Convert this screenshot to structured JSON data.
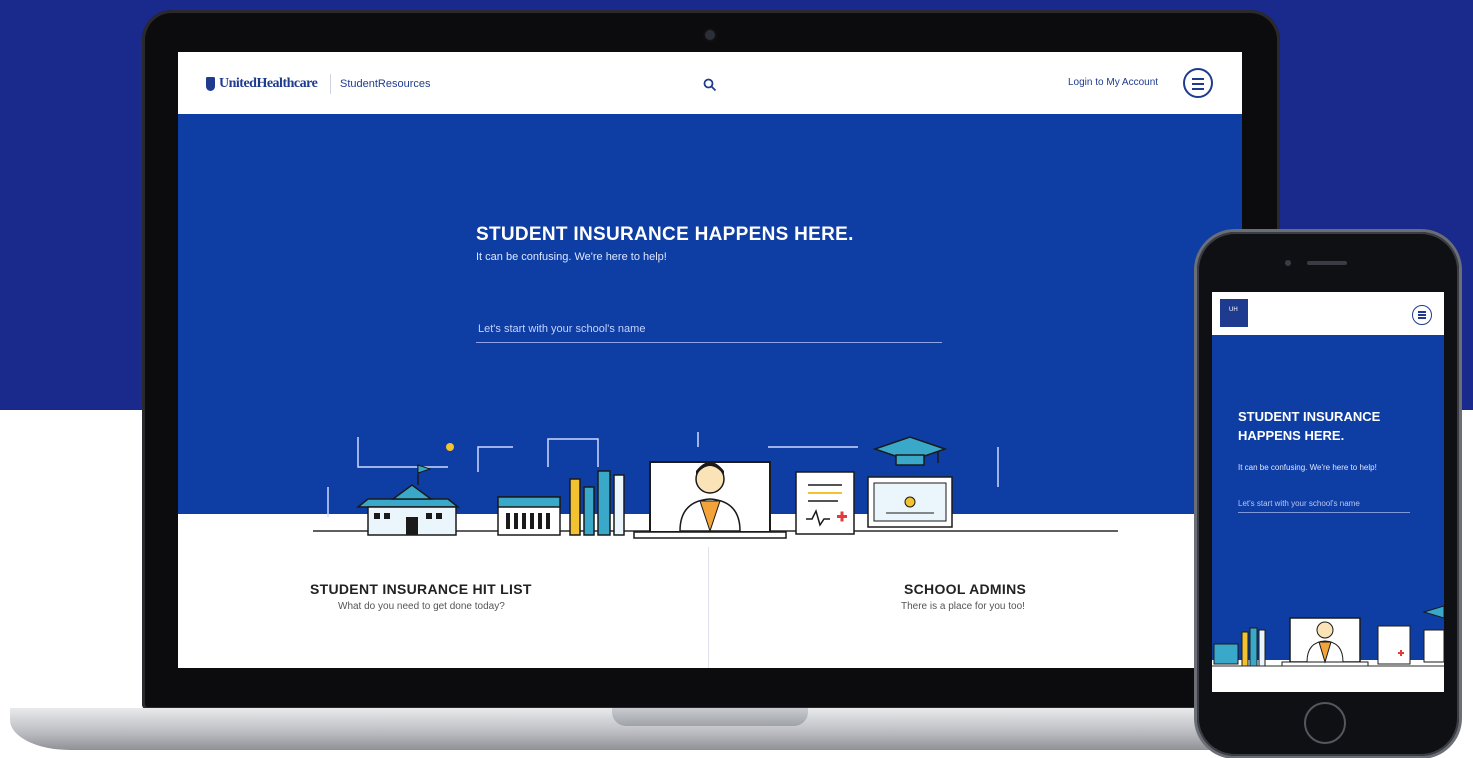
{
  "desktop": {
    "brand": "UnitedHealthcare",
    "brand_section": "StudentResources",
    "login_label": "Login to My Account",
    "hero": {
      "title": "STUDENT INSURANCE HAPPENS HERE.",
      "subtitle": "It can be confusing. We're here to help!",
      "search_placeholder": "Let's start with your school's name"
    },
    "cards": [
      {
        "title": "STUDENT INSURANCE HIT LIST",
        "subtitle": "What do you need to get done today?"
      },
      {
        "title": "SCHOOL ADMINS",
        "subtitle": "There is a place for you too!"
      }
    ]
  },
  "mobile": {
    "logo_text": "UH",
    "hero_title": "STUDENT INSURANCE HAPPENS HERE.",
    "hero_subtitle": "It can be confusing. We're here to help!",
    "search_placeholder": "Let's start with your school's name"
  },
  "icons": [
    "search-icon",
    "menu-icon",
    "school-building-icon",
    "calendar-icon",
    "books-icon",
    "doctor-laptop-icon",
    "medical-chart-icon",
    "graduation-cap-icon",
    "certificate-icon"
  ],
  "colors": {
    "page_background": "#1a2a8c",
    "hero_blue": "#0e3ea3",
    "brand_navy": "#1f3b8f",
    "accent_teal": "#3aa9c9",
    "accent_yellow": "#f2c230",
    "accent_red": "#e23b3b"
  }
}
